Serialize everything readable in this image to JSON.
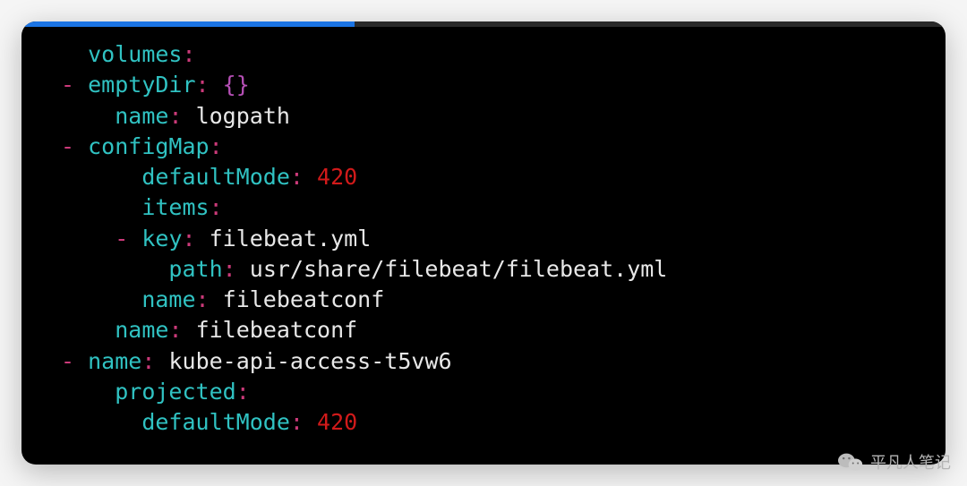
{
  "progress": {
    "percent": 36
  },
  "watermark": {
    "label": "平凡人笔记"
  },
  "code": {
    "lines": [
      {
        "indent": 0,
        "dash": false,
        "key": "volumes",
        "valueType": "none"
      },
      {
        "indent": 0,
        "dash": true,
        "key": "emptyDir",
        "valueType": "braces",
        "value": "{}"
      },
      {
        "indent": 1,
        "dash": false,
        "key": "name",
        "valueType": "string",
        "value": "logpath"
      },
      {
        "indent": 0,
        "dash": true,
        "key": "configMap",
        "valueType": "none"
      },
      {
        "indent": 2,
        "dash": false,
        "key": "defaultMode",
        "valueType": "number",
        "value": "420"
      },
      {
        "indent": 2,
        "dash": false,
        "key": "items",
        "valueType": "none"
      },
      {
        "indent": 2,
        "dash": true,
        "key": "key",
        "valueType": "string",
        "value": "filebeat.yml"
      },
      {
        "indent": 3,
        "dash": false,
        "key": "path",
        "valueType": "string",
        "value": "usr/share/filebeat/filebeat.yml"
      },
      {
        "indent": 2,
        "dash": false,
        "key": "name",
        "valueType": "string",
        "value": "filebeatconf"
      },
      {
        "indent": 1,
        "dash": false,
        "key": "name",
        "valueType": "string",
        "value": "filebeatconf"
      },
      {
        "indent": 0,
        "dash": true,
        "key": "name",
        "valueType": "string",
        "value": "kube-api-access-t5vw6"
      },
      {
        "indent": 1,
        "dash": false,
        "key": "projected",
        "valueType": "none"
      },
      {
        "indent": 2,
        "dash": false,
        "key": "defaultMode",
        "valueType": "number",
        "value": "420"
      }
    ]
  }
}
